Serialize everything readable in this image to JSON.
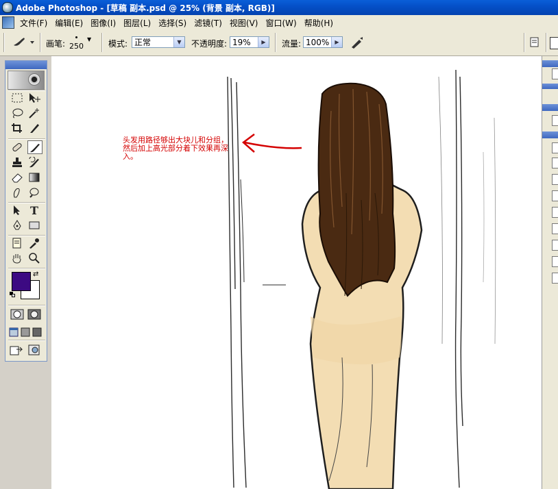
{
  "window": {
    "title": "Adobe Photoshop - [草稿 副本.psd @ 25% (背景 副本, RGB)]"
  },
  "menu": [
    "文件(F)",
    "编辑(E)",
    "图像(I)",
    "图层(L)",
    "选择(S)",
    "滤镜(T)",
    "视图(V)",
    "窗口(W)",
    "帮助(H)"
  ],
  "options": {
    "brush_label": "画笔:",
    "brush_size": "250",
    "mode_label": "模式:",
    "mode_value": "正常",
    "opacity_label": "不透明度:",
    "opacity_value": "19%",
    "flow_label": "流量:",
    "flow_value": "100%"
  },
  "toolbox": {
    "tools": [
      "marquee-tool",
      "move-tool",
      "lasso-tool",
      "magic-wand-tool",
      "crop-tool",
      "slice-tool",
      "healing-brush-tool",
      "brush-tool",
      "clone-stamp-tool",
      "history-brush-tool",
      "eraser-tool",
      "gradient-tool",
      "smudge-tool",
      "dodge-tool",
      "path-selection-tool",
      "type-tool",
      "pen-tool",
      "shape-tool",
      "notes-tool",
      "eyedropper-tool",
      "hand-tool",
      "zoom-tool"
    ],
    "active_tool": "brush-tool",
    "foreground_color": "#3c0a82",
    "background_color": "#ffffff"
  },
  "annotation": {
    "text": "头发用路径够出大块儿和分组，然后加上高光部分着下效果再深入。",
    "color": "#d40000"
  },
  "colors": {
    "title_bar": "#0550c8",
    "menu_bg": "#ece9d8",
    "canvas": "#ffffff"
  }
}
